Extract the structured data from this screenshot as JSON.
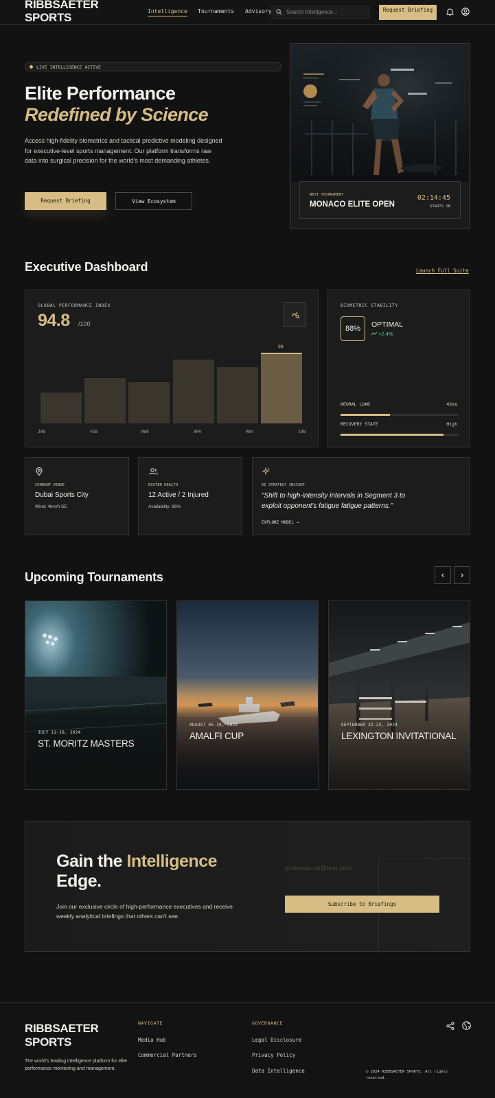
{
  "header": {
    "logo": [
      "RIBBSAETER",
      "SPORTS"
    ],
    "nav": [
      "Intelligence",
      "Tournaments",
      "Advisory"
    ],
    "search_placeholder": "Search Intelligence...",
    "cta": "Request Briefing"
  },
  "hero": {
    "badge": "LIVE INTELLIGENCE ACTIVE",
    "title_line1": "Elite Performance",
    "title_line2": "Redefined by Science",
    "description": "Access high-fidelity biometrics and tactical predictive modeling designed for executive-level sports management. Our platform transforms raw data into surgical precision for the world's most demanding athletes.",
    "primary_button": "Request Briefing",
    "secondary_button": "View Ecosystem",
    "next_label": "NEXT TOURNAMENT",
    "next_name": "MONACO ELITE OPEN",
    "countdown": "02:14:45",
    "countdown_label": "STARTS IN"
  },
  "dashboard": {
    "title": "Executive Dashboard",
    "launch_link": "Launch Full Suite",
    "gpi_label": "GLOBAL PERFORMANCE INDEX",
    "gpi_value": "94.8",
    "gpi_scale": "/100",
    "biometric_label": "BIOMETRIC STABILITY",
    "biometric_pct": "88%",
    "biometric_status": "OPTIMAL",
    "biometric_delta": "+2.4%",
    "neural_label": "NEURAL LOAD",
    "neural_value": "42ms",
    "neural_fill": 0.42,
    "recovery_label": "RECOVERY STATE",
    "recovery_value": "High",
    "recovery_fill": 0.88,
    "venue_label": "CURRENT VENUE",
    "venue_value": "Dubai Sports City",
    "venue_sub": "Wind: 4km/h SE",
    "roster_label": "ROSTER HEALTH",
    "roster_value": "12 Active / 2 Injured",
    "roster_sub": "Availability: 86%",
    "ai_label": "AI STRATEGY INSIGHT",
    "ai_quote": "\"Shift to high-intensity intervals in Segment 3 to exploit opponent's fatigue fatigue patterns.\"",
    "ai_link": "EXPLORE MODEL"
  },
  "chart_data": {
    "type": "bar",
    "categories": [
      "JAN",
      "FEB",
      "MAR",
      "APR",
      "MAY",
      "JUN"
    ],
    "values": [
      44,
      65,
      59,
      91,
      81,
      101
    ],
    "highlight_index": 5,
    "data_labels": {
      "5": "98"
    },
    "ylim": [
      0,
      110
    ]
  },
  "tournaments": {
    "title": "Upcoming Tournaments",
    "items": [
      {
        "date": "JULY 12-18, 2024",
        "name": "ST. MORITZ MASTERS"
      },
      {
        "date": "AUGUST 05-10, 2024",
        "name": "AMALFI CUP"
      },
      {
        "date": "SEPTEMBER 22-25, 2024",
        "name": "LEXINGTON INVITATIONAL"
      }
    ]
  },
  "cta": {
    "title_a": "Gain the ",
    "title_b": "Intelligence",
    "title_c": "Edge.",
    "text": "Join our exclusive circle of high-performance executives and receive weekly analytical briefings that others can't see.",
    "email_placeholder": "professional@firm.com",
    "button": "Subscribe to Briefings"
  },
  "footer": {
    "logo": [
      "RIBBSAETER",
      "SPORTS"
    ],
    "tagline": "The world's leading intelligence platform for elite performance monitoring and management.",
    "navigate_heading": "NAVIGATE",
    "navigate": [
      "Media Hub",
      "Commercial Partners"
    ],
    "governance_heading": "GOVERNANCE",
    "governance": [
      "Legal Disclosure",
      "Privacy Policy",
      "Data Intelligence"
    ],
    "copyright": "© 2024 RIBBSAETER SPORTS. All rights reserved."
  },
  "colors": {
    "accent": "#d7bd84",
    "background": "#121212",
    "positive": "#4ad07a"
  }
}
